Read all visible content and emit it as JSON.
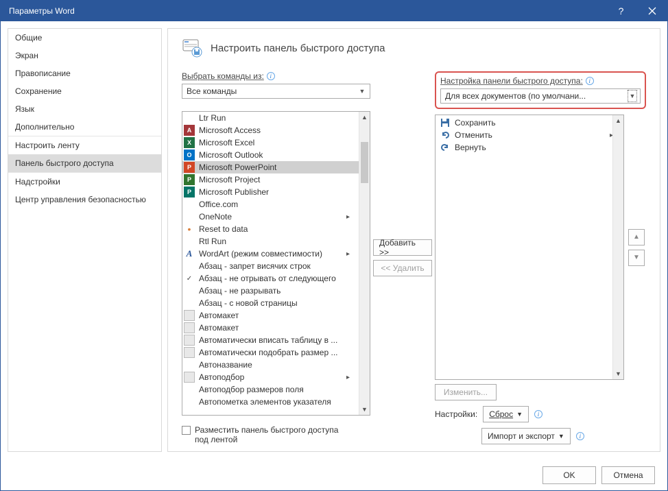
{
  "window": {
    "title": "Параметры Word"
  },
  "sidebar": {
    "items": [
      {
        "label": "Общие"
      },
      {
        "label": "Экран"
      },
      {
        "label": "Правописание"
      },
      {
        "label": "Сохранение"
      },
      {
        "label": "Язык"
      },
      {
        "label": "Дополнительно"
      },
      {
        "label": "Настроить ленту"
      },
      {
        "label": "Панель быстрого доступа"
      },
      {
        "label": "Надстройки"
      },
      {
        "label": "Центр управления безопасностью"
      }
    ]
  },
  "header": {
    "title": "Настроить панель быстрого доступа"
  },
  "left": {
    "choose_label": "Выбрать команды из:",
    "choose_value": "Все команды",
    "commands": [
      {
        "label": "Ltr Run",
        "icon": "blank"
      },
      {
        "label": "Microsoft Access",
        "icon": "access"
      },
      {
        "label": "Microsoft Excel",
        "icon": "excel"
      },
      {
        "label": "Microsoft Outlook",
        "icon": "outlook"
      },
      {
        "label": "Microsoft PowerPoint",
        "icon": "ppt",
        "selected": true
      },
      {
        "label": "Microsoft Project",
        "icon": "project"
      },
      {
        "label": "Microsoft Publisher",
        "icon": "publisher"
      },
      {
        "label": "Office.com",
        "icon": "blank"
      },
      {
        "label": "OneNote",
        "icon": "blank",
        "sub": true
      },
      {
        "label": "Reset to data",
        "icon": "dot"
      },
      {
        "label": "Rtl Run",
        "icon": "blank"
      },
      {
        "label": "WordArt (режим совместимости)",
        "icon": "wordart",
        "sub": true
      },
      {
        "label": "Абзац - запрет висячих строк",
        "icon": "blank"
      },
      {
        "label": "Абзац - не отрывать от следующего",
        "icon": "check"
      },
      {
        "label": "Абзац - не разрывать",
        "icon": "blank"
      },
      {
        "label": "Абзац - с новой страницы",
        "icon": "blank"
      },
      {
        "label": "Автомакет",
        "icon": "generic"
      },
      {
        "label": "Автомакет",
        "icon": "generic"
      },
      {
        "label": "Автоматически вписать таблицу в ...",
        "icon": "generic"
      },
      {
        "label": "Автоматически подобрать размер ...",
        "icon": "generic"
      },
      {
        "label": "Автоназвание",
        "icon": "blank"
      },
      {
        "label": "Автоподбор",
        "icon": "generic",
        "sub": true
      },
      {
        "label": "Автоподбор размеров поля",
        "icon": "blank"
      },
      {
        "label": "Автопометка элементов указателя",
        "icon": "blank"
      }
    ],
    "below_checkbox": "Разместить панель быстрого доступа под лентой"
  },
  "mid": {
    "add": "Добавить >>",
    "remove": "<< Удалить"
  },
  "right": {
    "customize_label": "Настройка панели быстрого доступа:",
    "customize_value": "Для всех документов (по умолчани...",
    "items": [
      {
        "label": "Сохранить",
        "icon": "save"
      },
      {
        "label": "Отменить",
        "icon": "undo",
        "sub": true
      },
      {
        "label": "Вернуть",
        "icon": "redo"
      }
    ],
    "modify": "Изменить...",
    "settings_label": "Настройки:",
    "reset": "Сброс",
    "import_export": "Импорт и экспорт"
  },
  "footer": {
    "ok": "OK",
    "cancel": "Отмена"
  }
}
